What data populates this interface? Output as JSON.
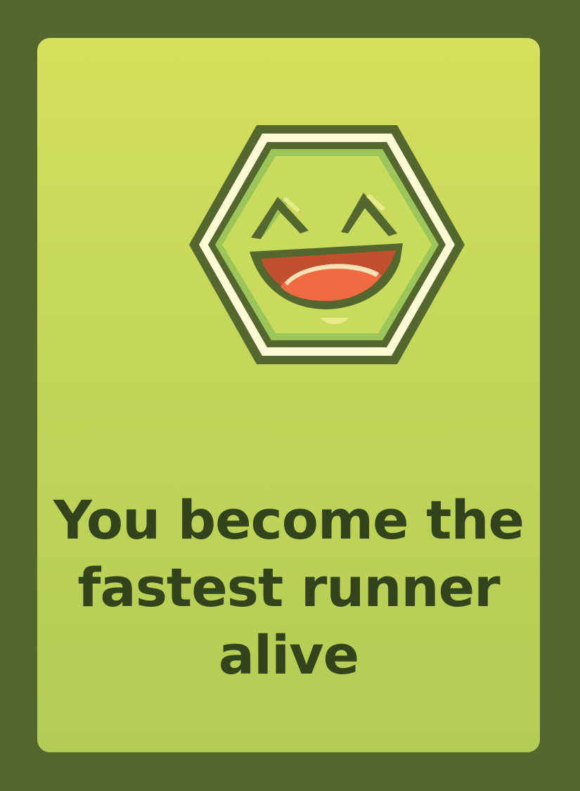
{
  "card": {
    "text": "You become the fastest runner alive",
    "emblem_icon": "laughing-face-hexagon-icon"
  },
  "colors": {
    "background": "#54672e",
    "card_top": "#d6e05c",
    "card_bottom": "#b3cc55",
    "text": "#33441c",
    "emblem_border": "#54672e",
    "emblem_ring": "#fdfbd6",
    "mouth": "#c0502e",
    "tongue": "#f26a42"
  }
}
